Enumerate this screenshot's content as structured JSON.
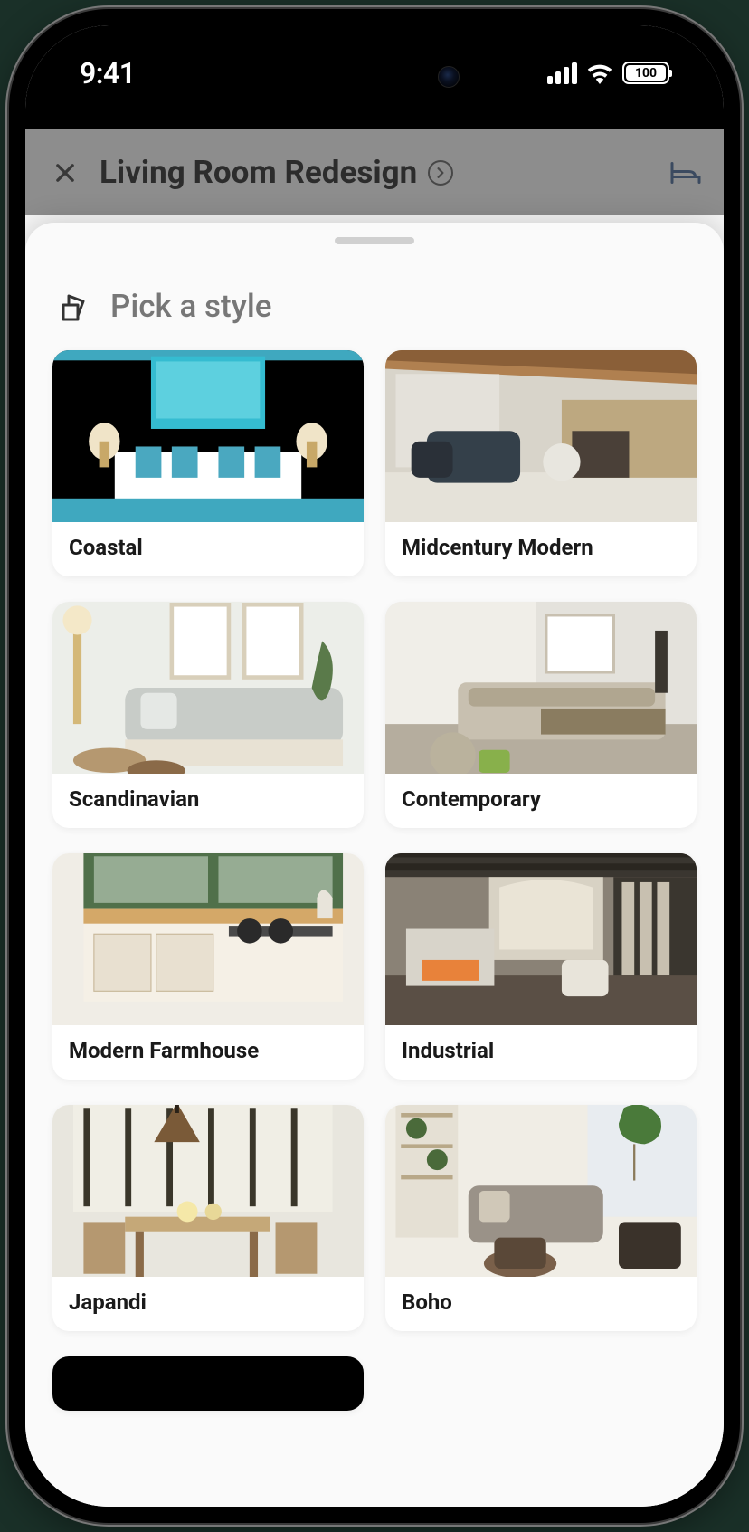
{
  "status": {
    "time": "9:41",
    "battery": "100"
  },
  "header": {
    "title": "Living Room Redesign"
  },
  "sheet": {
    "title": "Pick a style"
  },
  "styles": [
    {
      "label": "Coastal"
    },
    {
      "label": "Midcentury Modern"
    },
    {
      "label": "Scandinavian"
    },
    {
      "label": "Contemporary"
    },
    {
      "label": "Modern Farmhouse"
    },
    {
      "label": "Industrial"
    },
    {
      "label": "Japandi"
    },
    {
      "label": "Boho"
    }
  ]
}
